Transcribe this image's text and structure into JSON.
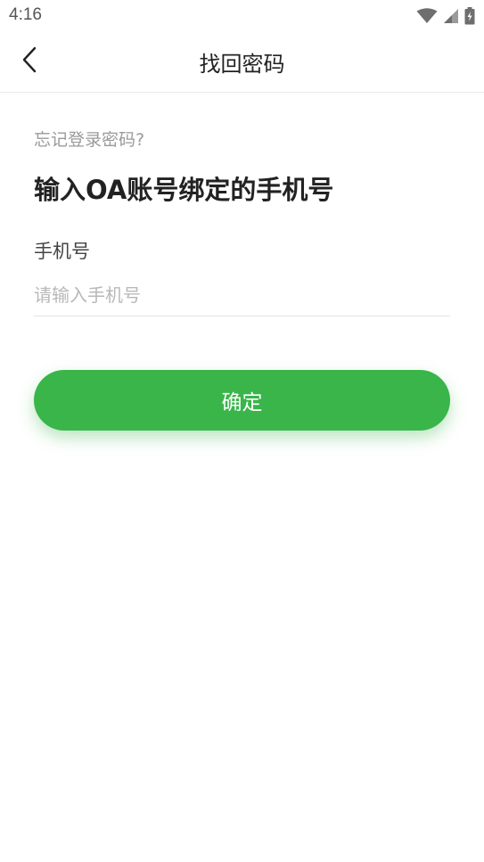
{
  "status_bar": {
    "time": "4:16",
    "icons": [
      "wifi-icon",
      "signal-icon",
      "battery-icon"
    ]
  },
  "header": {
    "back_icon": "chevron-left-icon",
    "title": "找回密码"
  },
  "form": {
    "hint": "忘记登录密码?",
    "heading": "输入OA账号绑定的手机号",
    "phone_label": "手机号",
    "phone_placeholder": "请输入手机号",
    "phone_value": ""
  },
  "confirm_button": {
    "label": "确定"
  },
  "colors": {
    "accent": "#39b54a",
    "text_primary": "#222222",
    "text_muted": "#9a9a9a",
    "placeholder": "#b8b8b8",
    "divider": "#e3e3e3"
  }
}
